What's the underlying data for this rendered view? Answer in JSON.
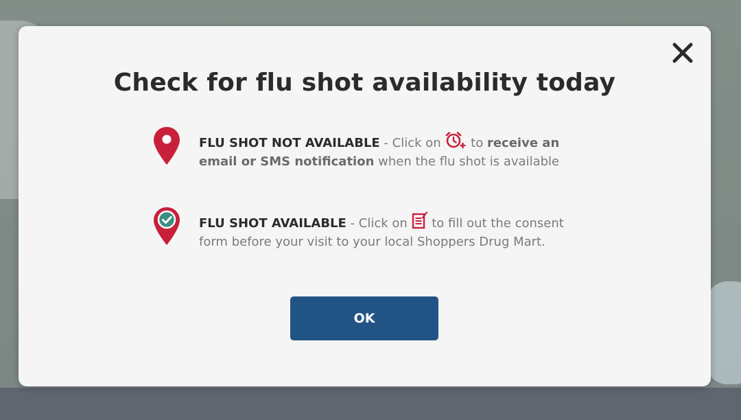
{
  "modal": {
    "title": "Check for flu shot availability today",
    "close_icon": "close-icon",
    "items": [
      {
        "icon": "location-pin-icon",
        "status": "FLU SHOT NOT AVAILABLE",
        "pre_icon_text": " - Click on ",
        "inline_icon": "alarm-clock-add-icon",
        "mid_text": " to ",
        "action_bold": "receive an email or SMS notification",
        "post_text": " when the flu shot is available"
      },
      {
        "icon": "location-pin-check-icon",
        "status": "FLU SHOT AVAILABLE",
        "pre_icon_text": " - Click on ",
        "inline_icon": "consent-form-icon",
        "post_text": " to fill out the consent form before your visit to your local Shoppers Drug Mart."
      }
    ],
    "ok_label": "OK"
  },
  "colors": {
    "accent_red": "#c8203b",
    "button_blue": "#225385",
    "check_teal": "#3d8f84",
    "title": "#2b2b2b",
    "body_text": "#7a7a7a"
  }
}
